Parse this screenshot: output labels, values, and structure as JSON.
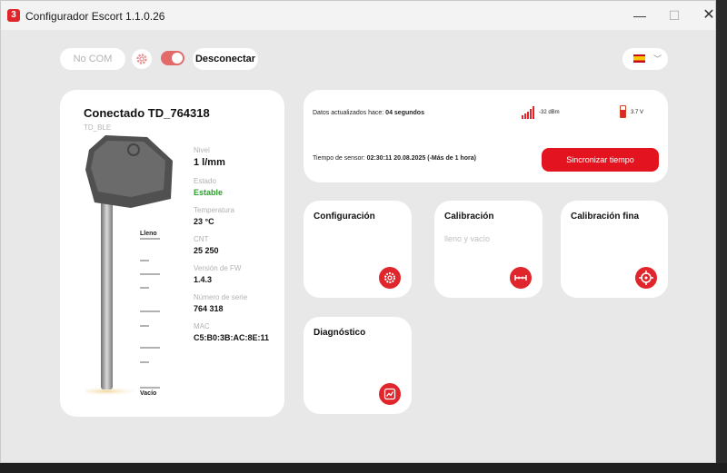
{
  "window": {
    "title": "Configurador Escort 1.1.0.26",
    "logo": "3",
    "minimize": "—",
    "maximize": "☐",
    "close": "✕"
  },
  "toolbar": {
    "com_placeholder": "No COM",
    "disconnect_label": "Desconectar",
    "toggle_on": true
  },
  "language": {
    "selected": "es"
  },
  "device": {
    "title": "Conectado  TD_764318",
    "subtitle": "TD_BLE",
    "scale_top": "Lleno",
    "scale_bottom": "Vacío",
    "fields": [
      {
        "label": "Nivel",
        "value": "1 l/mm"
      },
      {
        "label": "Estado",
        "value": "Estable"
      },
      {
        "label": "Temperatura",
        "value": "23 °C"
      },
      {
        "label": "CNT",
        "value": "25 250"
      },
      {
        "label": "Versión de FW",
        "value": "1.4.3"
      },
      {
        "label": "Número de serie",
        "value": "764 318"
      },
      {
        "label": "MAC",
        "value": "C5:B0:3B:AC:8E:11"
      }
    ]
  },
  "status": {
    "updated_label": "Datos actualizados hace:",
    "updated_value": "04 segundos",
    "signal": "-32 dBm",
    "battery": "3.7 V",
    "sensor_time_label": "Tiempo de sensor:",
    "sensor_time_value": "02:30:11 20.08.2025",
    "sensor_time_note": "(-Más de 1 hora)",
    "sync_label": "Sincronizar tiempo"
  },
  "tiles": {
    "config": "Configuración",
    "calib": "Calibración",
    "calib_sub": "lleno y vacío",
    "fine": "Calibración fina",
    "diag": "Diagnóstico"
  },
  "colors": {
    "accent": "#e0262c",
    "ok": "#2e9e2e"
  }
}
